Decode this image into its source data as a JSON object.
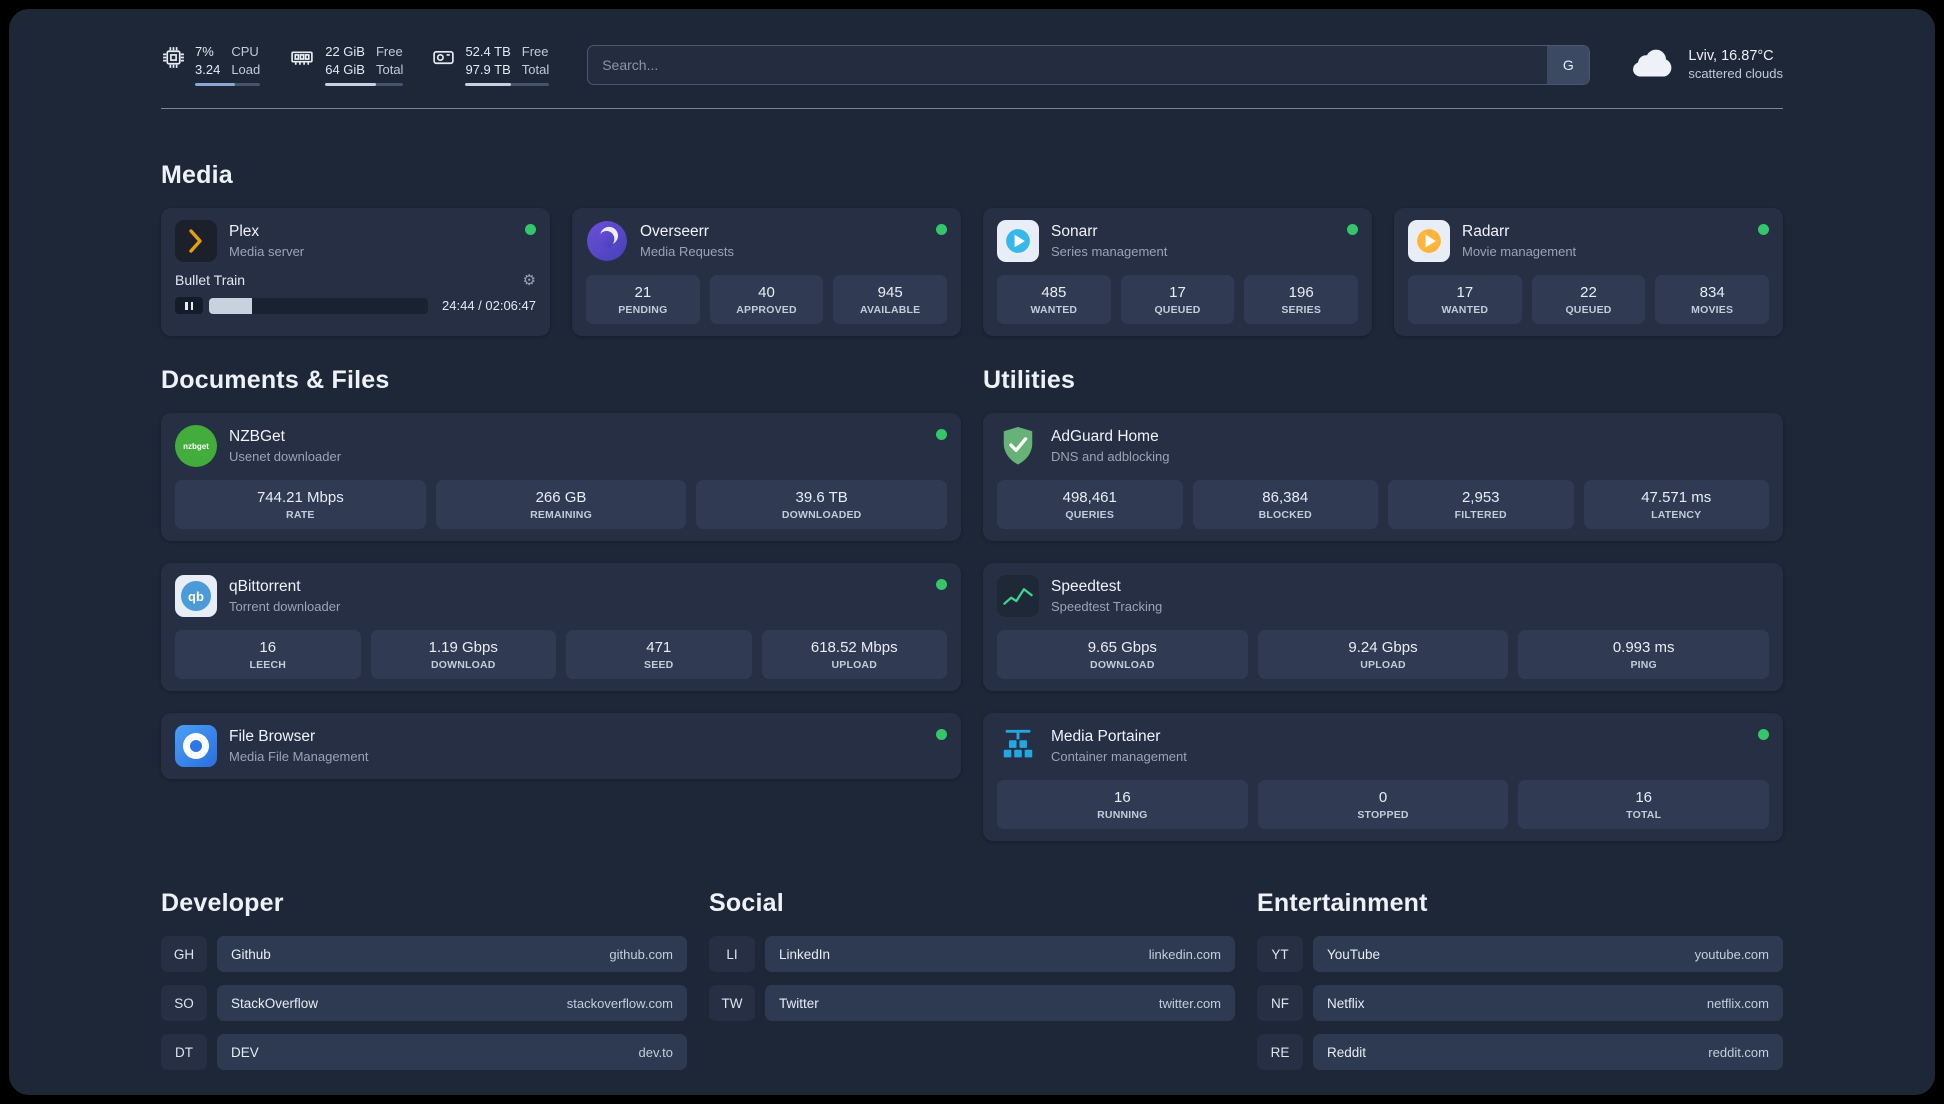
{
  "topbar": {
    "cpu": {
      "line1": "7%",
      "line2": "3.24",
      "label1": "CPU",
      "label2": "Load",
      "bar_style": "width:62%"
    },
    "memory": {
      "line1": "22 GiB",
      "line2": "64 GiB",
      "label1": "Free",
      "label2": "Total",
      "bar_style": "width:65%"
    },
    "disk": {
      "line1": "52.4 TB",
      "line2": "97.9 TB",
      "label1": "Free",
      "label2": "Total",
      "bar_style": "width:54%"
    },
    "search_placeholder": "Search...",
    "search_button": "G",
    "weather_location": "Lviv, 16.87°C",
    "weather_condition": "scattered clouds"
  },
  "section_titles": {
    "media": "Media",
    "documents": "Documents & Files",
    "utilities": "Utilities",
    "developer": "Developer",
    "social": "Social",
    "entertainment": "Entertainment"
  },
  "plex": {
    "name": "Plex",
    "subtitle": "Media server",
    "now_playing": "Bullet Train",
    "time": "24:44 / 02:06:47",
    "progress_style": "width:19.5%"
  },
  "overseerr": {
    "name": "Overseerr",
    "subtitle": "Media Requests",
    "stats": [
      {
        "v": "21",
        "l": "PENDING"
      },
      {
        "v": "40",
        "l": "APPROVED"
      },
      {
        "v": "945",
        "l": "AVAILABLE"
      }
    ]
  },
  "sonarr": {
    "name": "Sonarr",
    "subtitle": "Series management",
    "stats": [
      {
        "v": "485",
        "l": "WANTED"
      },
      {
        "v": "17",
        "l": "QUEUED"
      },
      {
        "v": "196",
        "l": "SERIES"
      }
    ]
  },
  "radarr": {
    "name": "Radarr",
    "subtitle": "Movie management",
    "stats": [
      {
        "v": "17",
        "l": "WANTED"
      },
      {
        "v": "22",
        "l": "QUEUED"
      },
      {
        "v": "834",
        "l": "MOVIES"
      }
    ]
  },
  "nzbget": {
    "name": "NZBGet",
    "subtitle": "Usenet downloader",
    "stats": [
      {
        "v": "744.21 Mbps",
        "l": "RATE"
      },
      {
        "v": "266 GB",
        "l": "REMAINING"
      },
      {
        "v": "39.6 TB",
        "l": "DOWNLOADED"
      }
    ]
  },
  "qbittorrent": {
    "name": "qBittorrent",
    "subtitle": "Torrent downloader",
    "stats": [
      {
        "v": "16",
        "l": "LEECH"
      },
      {
        "v": "1.19 Gbps",
        "l": "DOWNLOAD"
      },
      {
        "v": "471",
        "l": "SEED"
      },
      {
        "v": "618.52 Mbps",
        "l": "UPLOAD"
      }
    ]
  },
  "filebrowser": {
    "name": "File Browser",
    "subtitle": "Media File Management"
  },
  "adguard": {
    "name": "AdGuard Home",
    "subtitle": "DNS and adblocking",
    "stats": [
      {
        "v": "498,461",
        "l": "QUERIES"
      },
      {
        "v": "86,384",
        "l": "BLOCKED"
      },
      {
        "v": "2,953",
        "l": "FILTERED"
      },
      {
        "v": "47.571 ms",
        "l": "LATENCY"
      }
    ]
  },
  "speedtest": {
    "name": "Speedtest",
    "subtitle": "Speedtest Tracking",
    "stats": [
      {
        "v": "9.65 Gbps",
        "l": "DOWNLOAD"
      },
      {
        "v": "9.24 Gbps",
        "l": "UPLOAD"
      },
      {
        "v": "0.993 ms",
        "l": "PING"
      }
    ]
  },
  "portainer": {
    "name": "Media Portainer",
    "subtitle": "Container management",
    "stats": [
      {
        "v": "16",
        "l": "RUNNING"
      },
      {
        "v": "0",
        "l": "STOPPED"
      },
      {
        "v": "16",
        "l": "TOTAL"
      }
    ]
  },
  "icons": {
    "nzbget_text": "nzbget",
    "qb_text": "qb"
  },
  "bookmarks": {
    "developer": [
      {
        "abbr": "GH",
        "name": "Github",
        "url": "github.com"
      },
      {
        "abbr": "SO",
        "name": "StackOverflow",
        "url": "stackoverflow.com"
      },
      {
        "abbr": "DT",
        "name": "DEV",
        "url": "dev.to"
      }
    ],
    "social": [
      {
        "abbr": "LI",
        "name": "LinkedIn",
        "url": "linkedin.com"
      },
      {
        "abbr": "TW",
        "name": "Twitter",
        "url": "twitter.com"
      }
    ],
    "entertainment": [
      {
        "abbr": "YT",
        "name": "YouTube",
        "url": "youtube.com"
      },
      {
        "abbr": "NF",
        "name": "Netflix",
        "url": "netflix.com"
      },
      {
        "abbr": "RE",
        "name": "Reddit",
        "url": "reddit.com"
      }
    ]
  }
}
